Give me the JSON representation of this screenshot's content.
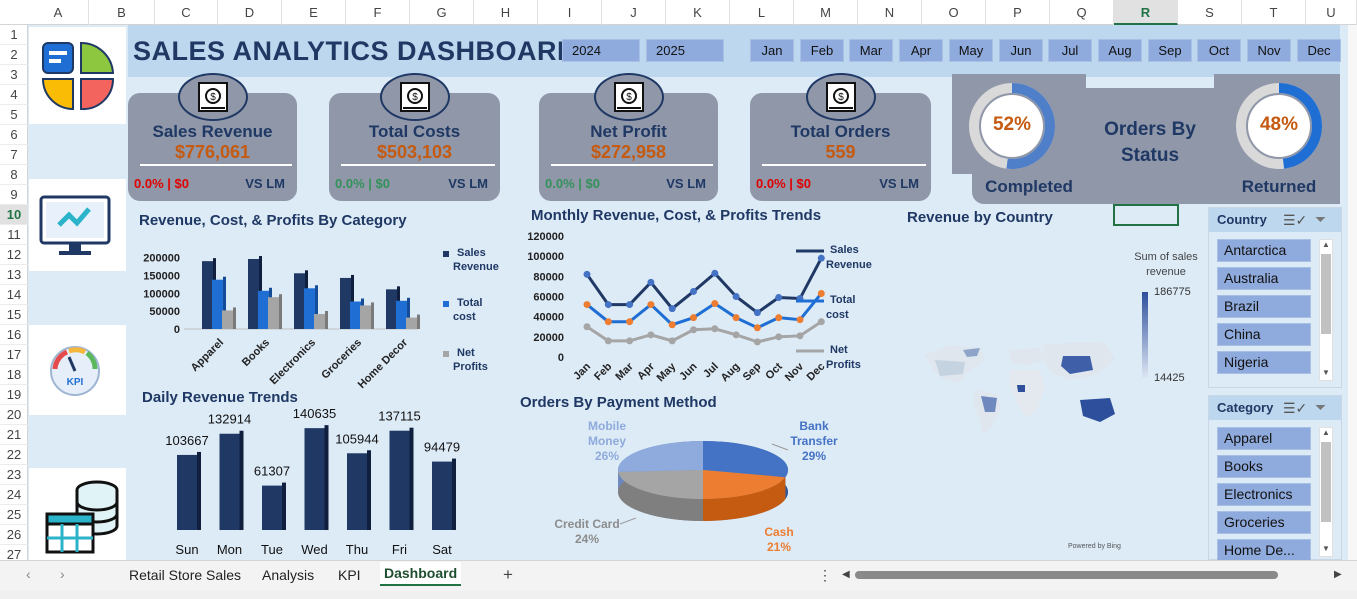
{
  "columns": [
    "A",
    "B",
    "C",
    "D",
    "E",
    "F",
    "G",
    "H",
    "I",
    "J",
    "K",
    "L",
    "M",
    "N",
    "O",
    "P",
    "Q",
    "R",
    "S",
    "T",
    "U"
  ],
  "rows": [
    "1",
    "2",
    "3",
    "4",
    "5",
    "6",
    "7",
    "8",
    "9",
    "10",
    "11",
    "12",
    "13",
    "14",
    "15",
    "16",
    "17",
    "18",
    "19",
    "20",
    "21",
    "22",
    "23",
    "24",
    "25",
    "26",
    "27"
  ],
  "selected_column": "R",
  "selected_row": "10",
  "title": "SALES ANALYTICS DASHBOARD",
  "years": [
    "2024",
    "2025"
  ],
  "months": [
    "Jan",
    "Feb",
    "Mar",
    "Apr",
    "May",
    "Jun",
    "Jul",
    "Aug",
    "Sep",
    "Oct",
    "Nov",
    "Dec"
  ],
  "kpis": [
    {
      "title": "Sales Revenue",
      "value": "$776,061",
      "change": "0.0% | $0",
      "vs": "VS LM",
      "change_color": "red"
    },
    {
      "title": "Total Costs",
      "value": "$503,103",
      "change": "0.0% | $0",
      "vs": "VS LM",
      "change_color": "green"
    },
    {
      "title": "Net Profit",
      "value": "$272,958",
      "change": "0.0% | $0",
      "vs": "VS LM",
      "change_color": "green"
    },
    {
      "title": "Total Orders",
      "value": "559",
      "change": "0.0% | $0",
      "vs": "VS LM",
      "change_color": "red"
    }
  ],
  "orders_status": {
    "title_line1": "Orders By",
    "title_line2": "Status",
    "completed_pct": "52%",
    "completed_label": "Completed",
    "returned_pct": "48%",
    "returned_label": "Returned"
  },
  "sections": {
    "category_chart": "Revenue, Cost, & Profits By Category",
    "monthly_chart": "Monthly Revenue, Cost, & Profits Trends",
    "country_map": "Revenue by Country",
    "daily_chart": "Daily Revenue Trends",
    "payment_chart": "Orders By Payment Method"
  },
  "map": {
    "legend_title_1": "Sum of sales",
    "legend_title_2": "revenue",
    "legend_max": "186775",
    "legend_min": "14425",
    "credit": "Powered by Bing"
  },
  "country_slicer": {
    "title": "Country",
    "items": [
      "Antarctica",
      "Australia",
      "Brazil",
      "China",
      "Nigeria"
    ]
  },
  "category_slicer": {
    "title": "Category",
    "items": [
      "Apparel",
      "Books",
      "Electronics",
      "Groceries",
      "Home De..."
    ]
  },
  "sheet_tabs": [
    "Retail Store Sales",
    "Analysis",
    "KPI",
    "Dashboard"
  ],
  "active_tab": "Dashboard",
  "add_sheet": "+",
  "colors": {
    "navy": "#1f3864",
    "blue": "#1f6ed4",
    "gray": "#a5a5a5",
    "orange": "#ed7d31",
    "accent": "#c55a11"
  },
  "chart_data": [
    {
      "type": "bar",
      "title": "Revenue, Cost, & Profits By Category",
      "categories": [
        "Apparel",
        "Books",
        "Electronics",
        "Groceries",
        "Home Decor"
      ],
      "series": [
        {
          "name": "Sales Revenue",
          "values": [
            190000,
            196000,
            156000,
            143000,
            111000
          ]
        },
        {
          "name": "Total cost",
          "values": [
            138000,
            107000,
            114000,
            77000,
            79000
          ]
        },
        {
          "name": "Net Profits",
          "values": [
            52000,
            89000,
            42000,
            66000,
            32000
          ]
        }
      ],
      "yticks": [
        0,
        50000,
        100000,
        150000,
        200000
      ],
      "ylim": [
        0,
        210000
      ],
      "legend": "right"
    },
    {
      "type": "line",
      "title": "Monthly Revenue, Cost, & Profits Trends",
      "categories": [
        "Jan",
        "Feb",
        "Mar",
        "Apr",
        "May",
        "Jun",
        "Jul",
        "Aug",
        "Sep",
        "Oct",
        "Nov",
        "Dec"
      ],
      "series": [
        {
          "name": "Sales Revenue",
          "values": [
            82000,
            52000,
            52000,
            74000,
            48000,
            65000,
            83000,
            60000,
            44000,
            59000,
            58000,
            98000
          ]
        },
        {
          "name": "Total cost",
          "values": [
            52000,
            35000,
            35000,
            52000,
            32000,
            39000,
            53000,
            39000,
            29000,
            39000,
            37000,
            63000
          ]
        },
        {
          "name": "Net Profits",
          "values": [
            30000,
            16000,
            16000,
            22000,
            16000,
            27000,
            28000,
            22000,
            15000,
            20000,
            21000,
            35000
          ]
        }
      ],
      "yticks": [
        0,
        20000,
        40000,
        60000,
        80000,
        100000,
        120000
      ],
      "ylim": [
        0,
        120000
      ],
      "legend": "right"
    },
    {
      "type": "bar",
      "title": "Daily Revenue Trends",
      "categories": [
        "Sun",
        "Mon",
        "Tue",
        "Wed",
        "Thu",
        "Fri",
        "Sat"
      ],
      "values": [
        103667,
        132914,
        61307,
        140635,
        105944,
        137115,
        94479
      ],
      "data_labels": [
        "103667",
        "132914",
        "61307",
        "140635",
        "105944",
        "137115",
        "94479"
      ]
    },
    {
      "type": "pie",
      "title": "Orders By Payment Method",
      "labels": [
        "Bank Transfer",
        "Cash",
        "Credit Card",
        "Mobile Money"
      ],
      "label_lines": [
        [
          "Bank",
          "Transfer"
        ],
        [
          "Cash"
        ],
        [
          "Credit Card"
        ],
        [
          "Mobile",
          "Money"
        ]
      ],
      "values": [
        29,
        21,
        24,
        26
      ],
      "pct_labels": [
        "29%",
        "21%",
        "24%",
        "26%"
      ],
      "colors": [
        "#4472c4",
        "#ed7d31",
        "#a5a5a5",
        "#8faadc"
      ]
    }
  ]
}
